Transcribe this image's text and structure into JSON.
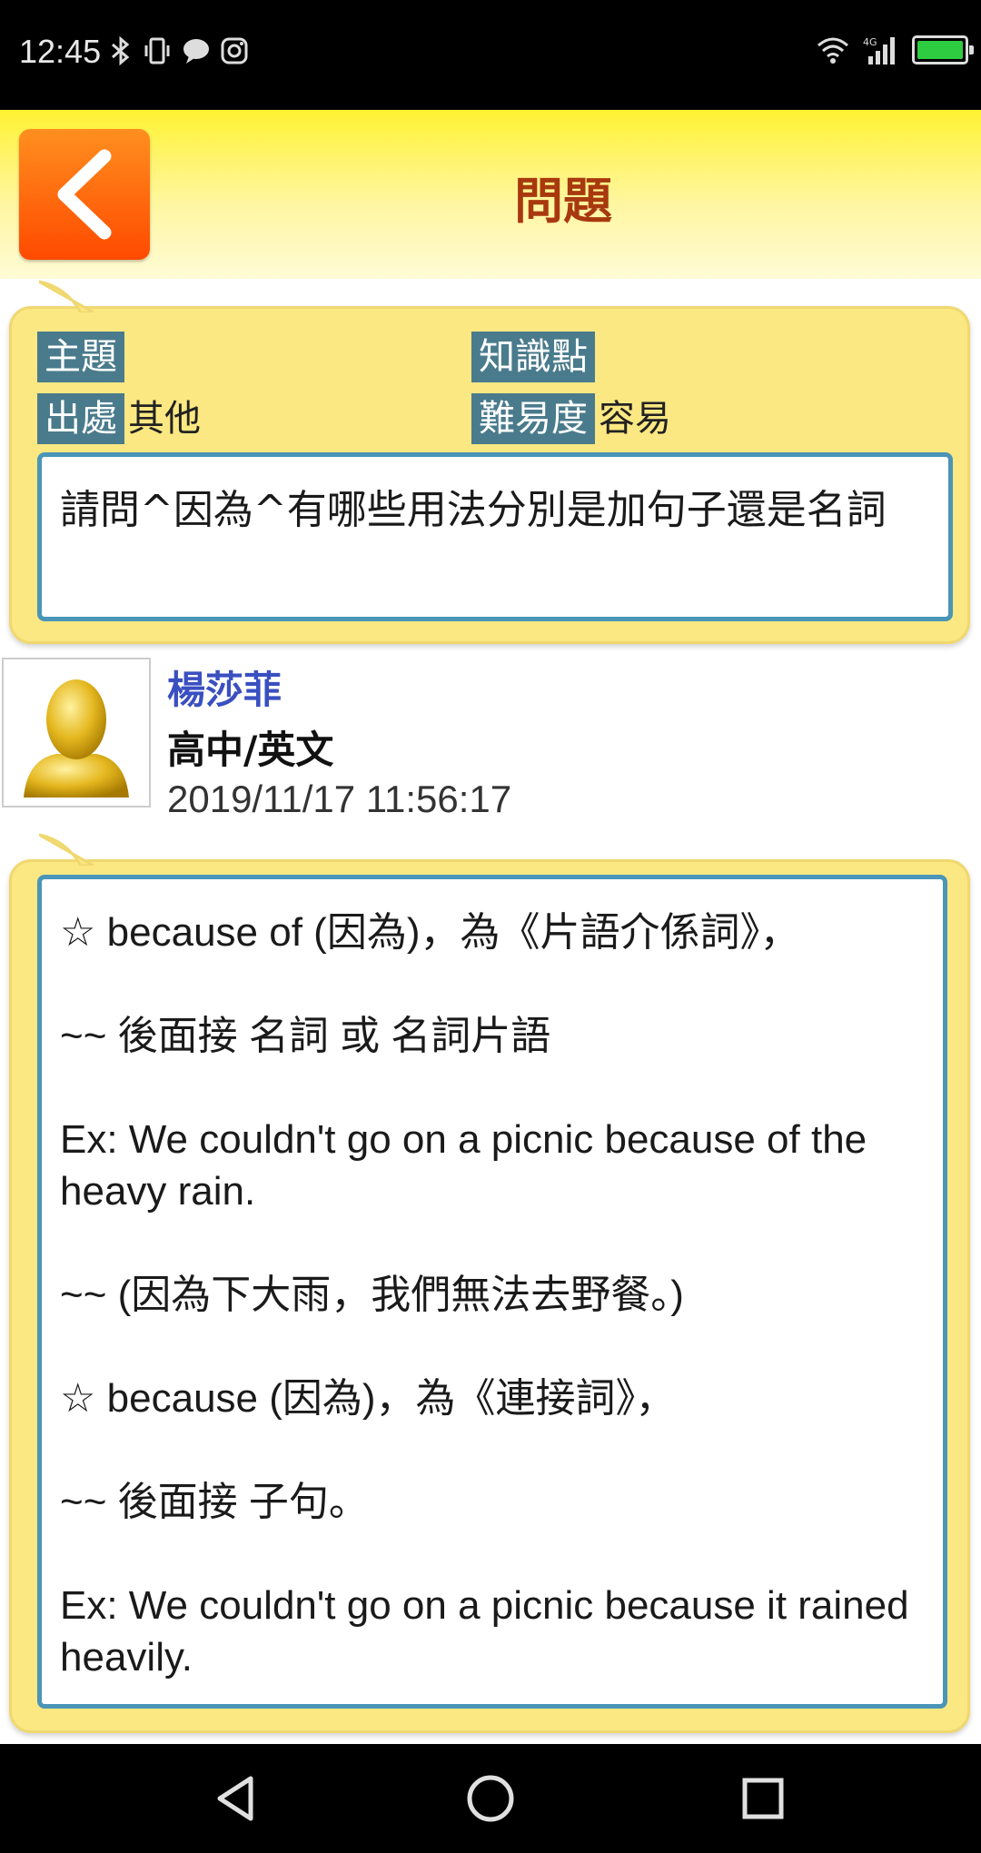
{
  "status_bar": {
    "time": "12:45",
    "network": "4G",
    "battery_color": "#2ecc40"
  },
  "header": {
    "title": "問題",
    "back_icon": "chevron-left-icon"
  },
  "question": {
    "topic_label": "主題",
    "topic_value": "",
    "knowledge_label": "知識點",
    "knowledge_value": "",
    "source_label": "出處",
    "source_value": "其他",
    "difficulty_label": "難易度",
    "difficulty_value": "容易",
    "text": "請問^因為^有哪些用法分別是加句子還是名詞"
  },
  "author": {
    "name": "楊莎菲",
    "school": "高中/英文",
    "timestamp": "2019/11/17 11:56:17"
  },
  "answer": {
    "lines": [
      "☆ because of (因為)，為《片語介係詞》，",
      "",
      "~~ 後面接 名詞 或 名詞片語",
      "",
      "Ex: We couldn't go on a picnic because of the heavy rain.",
      "",
      "~~ (因為下大雨，我們無法去野餐。)",
      "",
      "☆ because (因為)，為《連接詞》，",
      "",
      "~~ 後面接 子句。",
      "",
      "Ex: We couldn't go on a picnic because it rained heavily."
    ]
  },
  "colors": {
    "header_gradient_top": "#fff233",
    "back_button": "#ff6a0a",
    "title": "#a8390f",
    "card_bg": "#fbe882",
    "tag_bg": "#4a7b8c",
    "textbox_border": "#4a95b8",
    "author_name": "#3a4fc0"
  },
  "nav": {
    "back": "triangle-back-icon",
    "home": "circle-home-icon",
    "recents": "square-recents-icon"
  }
}
